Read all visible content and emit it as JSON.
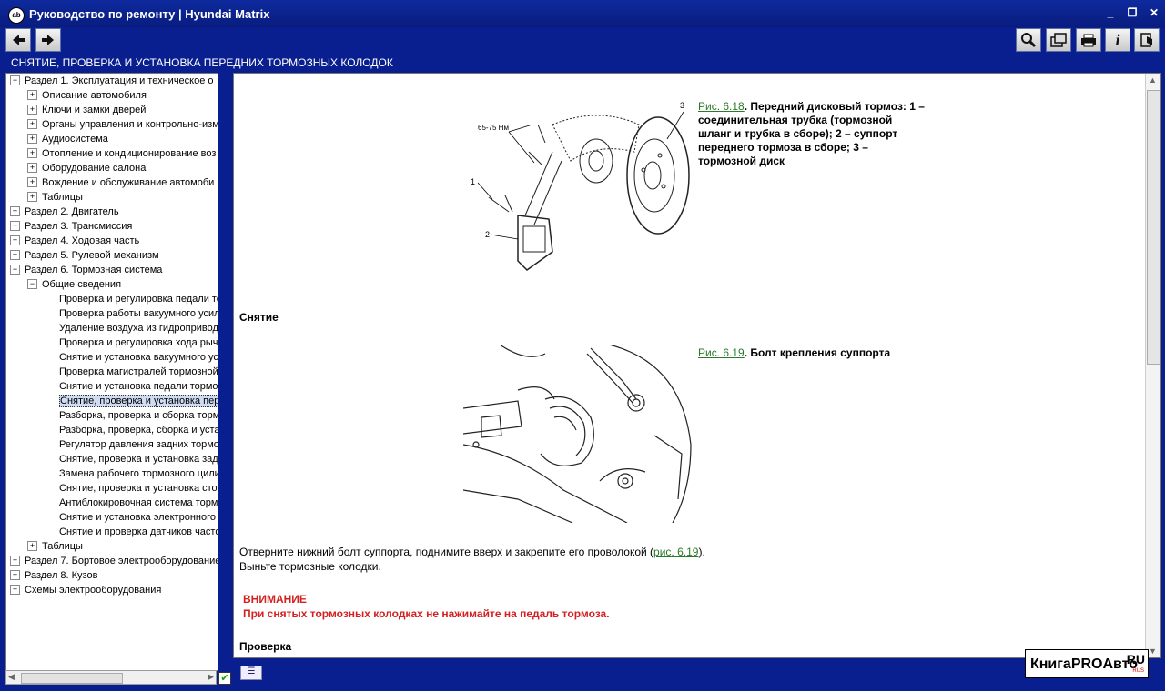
{
  "window": {
    "title": "Руководство по ремонту | Hyundai Matrix",
    "app_icon": "doc-icon"
  },
  "section_title": "СНЯТИЕ, ПРОВЕРКА И УСТАНОВКА ПЕРЕДНИХ ТОРМОЗНЫХ КОЛОДОК",
  "tree": [
    {
      "label": "Раздел 1. Эксплуатация и техническое о",
      "exp": "−",
      "level": 0
    },
    {
      "label": "Описание автомобиля",
      "exp": "+",
      "level": 1
    },
    {
      "label": "Ключи и замки дверей",
      "exp": "+",
      "level": 1
    },
    {
      "label": "Органы управления и контрольно-изм",
      "exp": "+",
      "level": 1
    },
    {
      "label": "Аудиосистема",
      "exp": "+",
      "level": 1
    },
    {
      "label": "Отопление и кондиционирование воз",
      "exp": "+",
      "level": 1
    },
    {
      "label": "Оборудование салона",
      "exp": "+",
      "level": 1
    },
    {
      "label": "Вождение и обслуживание автомоби",
      "exp": "+",
      "level": 1
    },
    {
      "label": "Таблицы",
      "exp": "+",
      "level": 1
    },
    {
      "label": "Раздел 2. Двигатель",
      "exp": "+",
      "level": 0
    },
    {
      "label": "Раздел 3. Трансмиссия",
      "exp": "+",
      "level": 0
    },
    {
      "label": "Раздел 4. Ходовая часть",
      "exp": "+",
      "level": 0
    },
    {
      "label": "Раздел 5. Рулевой механизм",
      "exp": "+",
      "level": 0
    },
    {
      "label": "Раздел 6. Тормозная система",
      "exp": "−",
      "level": 0
    },
    {
      "label": "Общие сведения",
      "exp": "−",
      "level": 1
    },
    {
      "label": "Проверка и регулировка педали тормоза",
      "exp": "",
      "level": 2
    },
    {
      "label": "Проверка работы вакуумного усилителя",
      "exp": "",
      "level": 2
    },
    {
      "label": "Удаление воздуха из гидропривода",
      "exp": "",
      "level": 2
    },
    {
      "label": "Проверка и регулировка хода рычага",
      "exp": "",
      "level": 2
    },
    {
      "label": "Снятие и установка вакуумного усилителя",
      "exp": "",
      "level": 2
    },
    {
      "label": "Проверка магистралей тормозной системы",
      "exp": "",
      "level": 2
    },
    {
      "label": "Снятие и установка педали тормоза",
      "exp": "",
      "level": 2
    },
    {
      "label": "Снятие, проверка и установка передних",
      "exp": "",
      "level": 2,
      "selected": true
    },
    {
      "label": "Разборка, проверка и сборка тормозного",
      "exp": "",
      "level": 2
    },
    {
      "label": "Разборка, проверка, сборка и установка",
      "exp": "",
      "level": 2
    },
    {
      "label": "Регулятор давления задних тормозов",
      "exp": "",
      "level": 2
    },
    {
      "label": "Снятие, проверка и установка задних",
      "exp": "",
      "level": 2
    },
    {
      "label": "Замена рабочего тормозного цилиндра",
      "exp": "",
      "level": 2
    },
    {
      "label": "Снятие, проверка и установка стояночного",
      "exp": "",
      "level": 2
    },
    {
      "label": "Антиблокировочная система тормозов",
      "exp": "",
      "level": 2
    },
    {
      "label": "Снятие и установка электронного блока",
      "exp": "",
      "level": 2
    },
    {
      "label": "Снятие и проверка датчиков частоты",
      "exp": "",
      "level": 2
    },
    {
      "label": "Таблицы",
      "exp": "+",
      "level": 1
    },
    {
      "label": "Раздел 7. Бортовое электрооборудование",
      "exp": "+",
      "level": 0
    },
    {
      "label": "Раздел 8. Кузов",
      "exp": "+",
      "level": 0
    },
    {
      "label": "Схемы электрооборудования",
      "exp": "+",
      "level": 0
    }
  ],
  "figure1": {
    "link": "Рис. 6.18",
    "caption": ". Передний дисковый тормоз: 1 – соединительная трубка (тормозной шланг и трубка в сборе); 2 – суппорт переднего тормоза в сборе; 3 – тормозной диск",
    "torque_label": "65-75 Нм",
    "callout_1": "1",
    "callout_2": "2",
    "callout_3": "3"
  },
  "heading_removal": "Снятие",
  "figure2": {
    "link": "Рис. 6.19",
    "caption": ". Болт крепления суппорта"
  },
  "para1_before": "Отверните нижний болт суппорта, поднимите вверх и закрепите его проволокой (",
  "para1_link": "рис. 6.19",
  "para1_after": ").",
  "para2": "Выньте тормозные колодки.",
  "warning": {
    "title": "ВНИМАНИЕ",
    "text": "При снятых тормозных колодках не нажимайте на педаль тормоза."
  },
  "heading_check": "Проверка",
  "logo": {
    "text": "КнигаPROАвто",
    "ru": "RU",
    "sub": "RUS"
  }
}
